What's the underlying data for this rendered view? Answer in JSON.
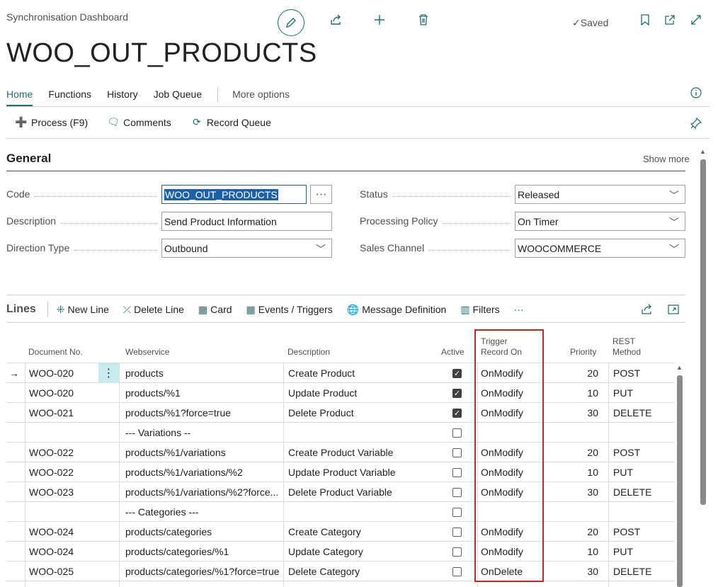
{
  "breadcrumb": "Synchronisation Dashboard",
  "saved_label": "Saved",
  "page_title": "WOO_OUT_PRODUCTS",
  "nav": {
    "tabs": [
      "Home",
      "Functions",
      "History",
      "Job Queue"
    ],
    "more": "More options"
  },
  "actions": [
    {
      "label": "Process (F9)",
      "icon": "process-icon"
    },
    {
      "label": "Comments",
      "icon": "comment-icon"
    },
    {
      "label": "Record Queue",
      "icon": "record-queue-icon"
    }
  ],
  "general": {
    "title": "General",
    "show_more": "Show more",
    "code_label": "Code",
    "code_value": "WOO_OUT_PRODUCTS",
    "description_label": "Description",
    "description_value": "Send Product Information",
    "direction_label": "Direction Type",
    "direction_value": "Outbound",
    "status_label": "Status",
    "status_value": "Released",
    "policy_label": "Processing Policy",
    "policy_value": "On Timer",
    "channel_label": "Sales Channel",
    "channel_value": "WOOCOMMERCE"
  },
  "lines": {
    "title": "Lines",
    "actions": [
      "New Line",
      "Delete Line",
      "Card",
      "Events / Triggers",
      "Message Definition",
      "Filters"
    ],
    "more": "···"
  },
  "grid": {
    "headers": {
      "doc": "Document No.",
      "webservice": "Webservice",
      "description": "Description",
      "active": "Active",
      "trigger1": "Trigger",
      "trigger2": "Record On",
      "priority": "Priority",
      "rest1": "REST",
      "rest2": "Method"
    },
    "rows": [
      {
        "doc": "WOO-020",
        "ws": "products",
        "desc": "Create Product",
        "active": true,
        "trigger": "OnModify",
        "priority": "20",
        "method": "POST"
      },
      {
        "doc": "WOO-020",
        "ws": "products/%1",
        "desc": "Update Product",
        "active": true,
        "trigger": "OnModify",
        "priority": "10",
        "method": "PUT"
      },
      {
        "doc": "WOO-021",
        "ws": "products/%1?force=true",
        "desc": "Delete Product",
        "active": true,
        "trigger": "OnModify",
        "priority": "30",
        "method": "DELETE"
      },
      {
        "doc": "",
        "ws": "--- Variations  --",
        "desc": "",
        "active": false,
        "trigger": "",
        "priority": "",
        "method": ""
      },
      {
        "doc": "WOO-022",
        "ws": "products/%1/variations",
        "desc": "Create Product Variable",
        "active": false,
        "trigger": "OnModify",
        "priority": "20",
        "method": "POST"
      },
      {
        "doc": "WOO-022",
        "ws": "products/%1/variations/%2",
        "desc": "Update Product Variable",
        "active": false,
        "trigger": "OnModify",
        "priority": "10",
        "method": "PUT"
      },
      {
        "doc": "WOO-023",
        "ws": "products/%1/variations/%2?force...",
        "desc": "Delete Product Variable",
        "active": false,
        "trigger": "OnModify",
        "priority": "30",
        "method": "DELETE"
      },
      {
        "doc": "",
        "ws": "--- Categories ---",
        "desc": "",
        "active": false,
        "trigger": "",
        "priority": "",
        "method": ""
      },
      {
        "doc": "WOO-024",
        "ws": "products/categories",
        "desc": "Create Category",
        "active": false,
        "trigger": "OnModify",
        "priority": "20",
        "method": "POST"
      },
      {
        "doc": "WOO-024",
        "ws": "products/categories/%1",
        "desc": "Update Category",
        "active": false,
        "trigger": "OnModify",
        "priority": "10",
        "method": "PUT"
      },
      {
        "doc": "WOO-025",
        "ws": "products/categories/%1?force=true",
        "desc": "Delete Category",
        "active": false,
        "trigger": "OnDelete",
        "priority": "30",
        "method": "DELETE"
      }
    ]
  },
  "colors": {
    "accent": "#1f6e6a",
    "highlight": "#d21f1f",
    "selection": "#1f5fa8"
  }
}
